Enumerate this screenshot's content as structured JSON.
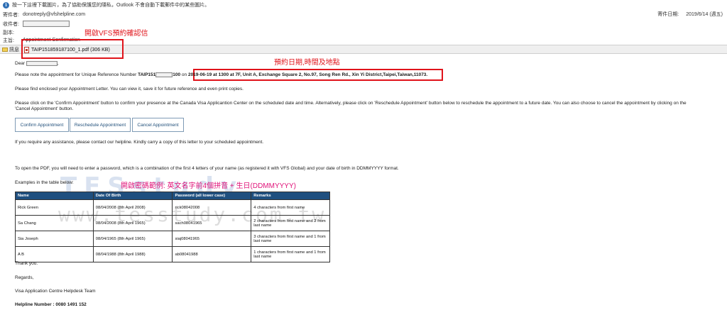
{
  "info_bar": {
    "text": "按一下這裡下載圖片，為了協助保護您的隱私，Outlook 不會自動下載郵件中的某些圖片。"
  },
  "header": {
    "from_label": "寄件者:",
    "from_value": "donotreply@vfshelpline.com",
    "to_label": "收件者:",
    "cc_label": "副本:",
    "subject_label": "主旨:",
    "subject_value": "Appointment Confirmation",
    "sent_label": "寄件日期:",
    "sent_value": "2019/6/14 (週五)"
  },
  "attachments": {
    "message_tab": "訊息",
    "file": "TAIP151859187100_1.pdf (306 KB)"
  },
  "annotations": {
    "open_pdf": "開啟VFS預約確認信",
    "appointment_info": "預約日期,時間及地點",
    "password_example": "開啟密碼範例: 英文名字前4個拼音 + 生日(DDMMYYYY)"
  },
  "watermark": {
    "line1": "TESstudy",
    "line2": "www.tesstudy.com.tw"
  },
  "body": {
    "greeting": "Dear",
    "greeting_end": ",",
    "ref_prefix": "Please note the appointment for Unique Reference Number ",
    "ref_start": "TAIP151",
    "ref_end": "100",
    "ref_on": " on ",
    "appointment_detail": "2019-06-19 at 1300 at 7F, Unit A, Exchange Square 2, No.97, Song Ren Rd., Xin Yi District,Taipei,Taiwan,11073.",
    "para_letter": "Please find enclosed your Appointment Letter. You can view it, save it for future reference and even print copies.",
    "para_click_1": "Please click on the 'Confirm Appointment' button to confirm your presence at the Canada Visa Applicantion Center on the scheduled date and time. Alternatively, please click on 'Reschedule Appointment' button below to reschedule the appointment to a future date. You can also choose to cancel the appointment by clicking on the",
    "para_click_2": "'Cancel Appointment' button.",
    "para_help": "If you require any assistance, please contact our helpline. Kindly carry a copy of this letter to your scheduled appointment.",
    "para_pdf": "To open the PDF, you will need to enter a password, which is a combination of the first 4 letters of your name (as registered it with VFS Global) and your date of birth in DDMMYYYY format.",
    "examples_label": "Examples in the table below:",
    "thanks": "Thank you.",
    "regards": "Regards,",
    "team": "Visa Application Centre Helpdesk Team",
    "helpline": "Helpline Number : 0080 1491 152"
  },
  "buttons": {
    "confirm": "Confirm Appointment",
    "reschedule": "Reschedule Appointment",
    "cancel": "Cancel Appointment"
  },
  "table": {
    "headers": [
      "Name",
      "Date Of Birth",
      "Password (all lower case)",
      "Remarks"
    ],
    "rows": [
      [
        "Rick Green",
        "08/04/2008 (8th April 2008)",
        "rick08042008",
        "4 characters from first name"
      ],
      [
        "Sa Chang",
        "08/04/2008 (8th April 1965)",
        "sach08041965",
        "2 characters from first name and 2 from last name"
      ],
      [
        "Sia Joseph",
        "08/04/1965 (8th April 1965)",
        "siaj08041965",
        "3 characters from first name and 1 from last name"
      ],
      [
        "A B",
        "08/04/1988 (8th April 1988)",
        "ab08041988",
        "1 characters from first name and 1 from last name"
      ]
    ]
  }
}
